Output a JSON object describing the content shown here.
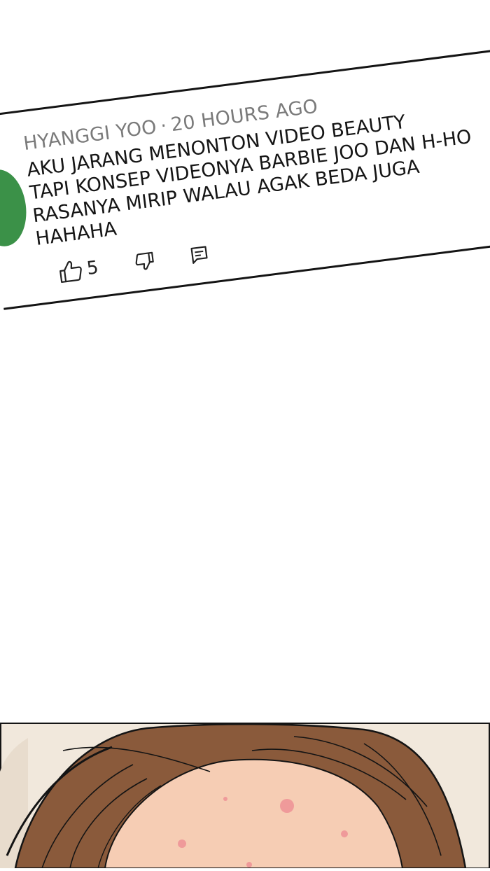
{
  "comment": {
    "author": "HYANGGI YOO",
    "separator": "·",
    "time": "20 HOURS AGO",
    "text_lines": [
      "AKU JARANG MENONTON VIDEO BEAUTY",
      "TAPI KONSEP VIDEONYA BARBIE JOO DAN H-HO",
      "RASANYA MIRIP WALAU AGAK BEDA JUGA",
      "HAHAHA"
    ],
    "like_count": "5",
    "avatar_color": "#3b9148"
  },
  "icons": {
    "like": "thumbs-up-icon",
    "dislike": "thumbs-down-icon",
    "reply": "reply-comment-icon"
  },
  "colors": {
    "hair": "#8a5a3b",
    "skin": "#f6cdb4",
    "blemish": "#ef9a9a",
    "wall": "#f1e8dc",
    "outline": "#141414"
  }
}
